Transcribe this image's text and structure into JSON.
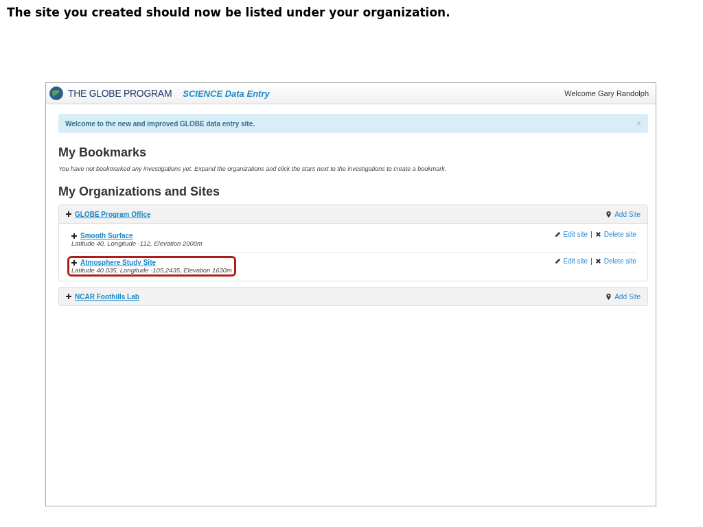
{
  "slide_title": "The site you created should now be listed under your organization.",
  "header": {
    "logo_text": "THE GLOBE PROGRAM",
    "app_title": "SCIENCE Data Entry",
    "welcome": "Welcome Gary Randolph"
  },
  "alert": {
    "message": "Welcome to the new and improved GLOBE data entry site.",
    "close": "×"
  },
  "bookmarks": {
    "heading": "My Bookmarks",
    "note": "You have not bookmarked any investigations yet. Expand the organizations and click the stars next to the investigations to create a bookmark."
  },
  "organizations": {
    "heading": "My Organizations and Sites",
    "items": [
      {
        "name": "GLOBE Program Office",
        "expanded": true,
        "add_site": "Add Site",
        "sites": [
          {
            "name": "Smooth Surface",
            "details": "Latitude 40, Longitude -112, Elevation 2000m",
            "edit": "Edit site",
            "separator": "|",
            "delete": "Delete site"
          },
          {
            "name": "Atmosphere Study Site",
            "details": "Latitude 40.035, Longitude -105.2435, Elevation 1630m",
            "edit": "Edit site",
            "separator": "|",
            "delete": "Delete site",
            "highlighted": true
          }
        ]
      },
      {
        "name": "NCAR Foothills Lab",
        "expanded": false,
        "add_site": "Add Site"
      }
    ]
  }
}
